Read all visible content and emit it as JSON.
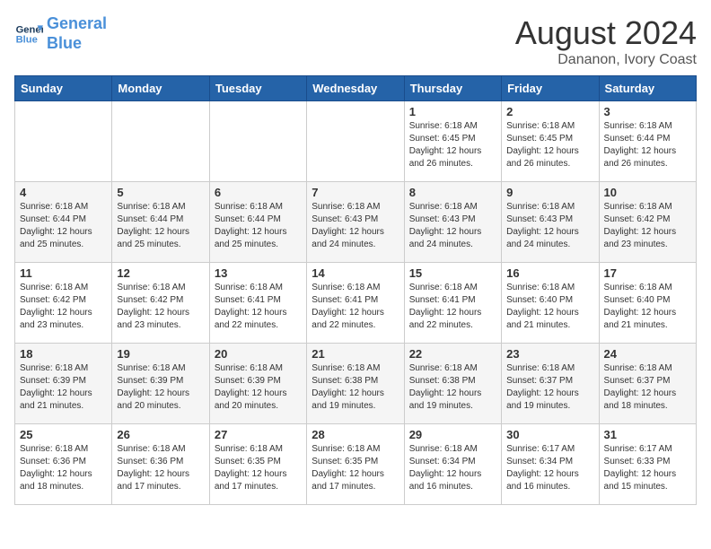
{
  "header": {
    "logo_line1": "General",
    "logo_line2": "Blue",
    "month_title": "August 2024",
    "location": "Dananon, Ivory Coast"
  },
  "days_of_week": [
    "Sunday",
    "Monday",
    "Tuesday",
    "Wednesday",
    "Thursday",
    "Friday",
    "Saturday"
  ],
  "weeks": [
    [
      {
        "day": "",
        "info": ""
      },
      {
        "day": "",
        "info": ""
      },
      {
        "day": "",
        "info": ""
      },
      {
        "day": "",
        "info": ""
      },
      {
        "day": "1",
        "info": "Sunrise: 6:18 AM\nSunset: 6:45 PM\nDaylight: 12 hours\nand 26 minutes."
      },
      {
        "day": "2",
        "info": "Sunrise: 6:18 AM\nSunset: 6:45 PM\nDaylight: 12 hours\nand 26 minutes."
      },
      {
        "day": "3",
        "info": "Sunrise: 6:18 AM\nSunset: 6:44 PM\nDaylight: 12 hours\nand 26 minutes."
      }
    ],
    [
      {
        "day": "4",
        "info": "Sunrise: 6:18 AM\nSunset: 6:44 PM\nDaylight: 12 hours\nand 25 minutes."
      },
      {
        "day": "5",
        "info": "Sunrise: 6:18 AM\nSunset: 6:44 PM\nDaylight: 12 hours\nand 25 minutes."
      },
      {
        "day": "6",
        "info": "Sunrise: 6:18 AM\nSunset: 6:44 PM\nDaylight: 12 hours\nand 25 minutes."
      },
      {
        "day": "7",
        "info": "Sunrise: 6:18 AM\nSunset: 6:43 PM\nDaylight: 12 hours\nand 24 minutes."
      },
      {
        "day": "8",
        "info": "Sunrise: 6:18 AM\nSunset: 6:43 PM\nDaylight: 12 hours\nand 24 minutes."
      },
      {
        "day": "9",
        "info": "Sunrise: 6:18 AM\nSunset: 6:43 PM\nDaylight: 12 hours\nand 24 minutes."
      },
      {
        "day": "10",
        "info": "Sunrise: 6:18 AM\nSunset: 6:42 PM\nDaylight: 12 hours\nand 23 minutes."
      }
    ],
    [
      {
        "day": "11",
        "info": "Sunrise: 6:18 AM\nSunset: 6:42 PM\nDaylight: 12 hours\nand 23 minutes."
      },
      {
        "day": "12",
        "info": "Sunrise: 6:18 AM\nSunset: 6:42 PM\nDaylight: 12 hours\nand 23 minutes."
      },
      {
        "day": "13",
        "info": "Sunrise: 6:18 AM\nSunset: 6:41 PM\nDaylight: 12 hours\nand 22 minutes."
      },
      {
        "day": "14",
        "info": "Sunrise: 6:18 AM\nSunset: 6:41 PM\nDaylight: 12 hours\nand 22 minutes."
      },
      {
        "day": "15",
        "info": "Sunrise: 6:18 AM\nSunset: 6:41 PM\nDaylight: 12 hours\nand 22 minutes."
      },
      {
        "day": "16",
        "info": "Sunrise: 6:18 AM\nSunset: 6:40 PM\nDaylight: 12 hours\nand 21 minutes."
      },
      {
        "day": "17",
        "info": "Sunrise: 6:18 AM\nSunset: 6:40 PM\nDaylight: 12 hours\nand 21 minutes."
      }
    ],
    [
      {
        "day": "18",
        "info": "Sunrise: 6:18 AM\nSunset: 6:39 PM\nDaylight: 12 hours\nand 21 minutes."
      },
      {
        "day": "19",
        "info": "Sunrise: 6:18 AM\nSunset: 6:39 PM\nDaylight: 12 hours\nand 20 minutes."
      },
      {
        "day": "20",
        "info": "Sunrise: 6:18 AM\nSunset: 6:39 PM\nDaylight: 12 hours\nand 20 minutes."
      },
      {
        "day": "21",
        "info": "Sunrise: 6:18 AM\nSunset: 6:38 PM\nDaylight: 12 hours\nand 19 minutes."
      },
      {
        "day": "22",
        "info": "Sunrise: 6:18 AM\nSunset: 6:38 PM\nDaylight: 12 hours\nand 19 minutes."
      },
      {
        "day": "23",
        "info": "Sunrise: 6:18 AM\nSunset: 6:37 PM\nDaylight: 12 hours\nand 19 minutes."
      },
      {
        "day": "24",
        "info": "Sunrise: 6:18 AM\nSunset: 6:37 PM\nDaylight: 12 hours\nand 18 minutes."
      }
    ],
    [
      {
        "day": "25",
        "info": "Sunrise: 6:18 AM\nSunset: 6:36 PM\nDaylight: 12 hours\nand 18 minutes."
      },
      {
        "day": "26",
        "info": "Sunrise: 6:18 AM\nSunset: 6:36 PM\nDaylight: 12 hours\nand 17 minutes."
      },
      {
        "day": "27",
        "info": "Sunrise: 6:18 AM\nSunset: 6:35 PM\nDaylight: 12 hours\nand 17 minutes."
      },
      {
        "day": "28",
        "info": "Sunrise: 6:18 AM\nSunset: 6:35 PM\nDaylight: 12 hours\nand 17 minutes."
      },
      {
        "day": "29",
        "info": "Sunrise: 6:18 AM\nSunset: 6:34 PM\nDaylight: 12 hours\nand 16 minutes."
      },
      {
        "day": "30",
        "info": "Sunrise: 6:17 AM\nSunset: 6:34 PM\nDaylight: 12 hours\nand 16 minutes."
      },
      {
        "day": "31",
        "info": "Sunrise: 6:17 AM\nSunset: 6:33 PM\nDaylight: 12 hours\nand 15 minutes."
      }
    ]
  ]
}
